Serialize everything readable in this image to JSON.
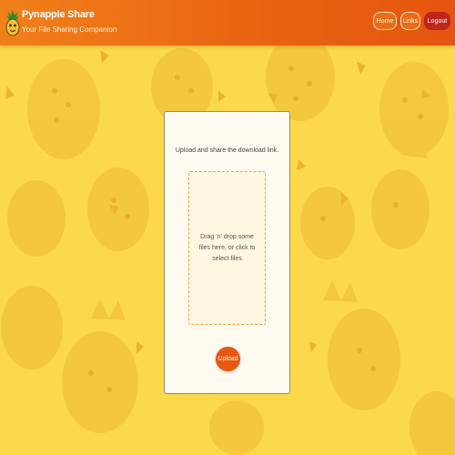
{
  "header": {
    "title": "Pynapple Share",
    "subtitle": "Your File Sharing Companion",
    "nav": {
      "home": "Home",
      "links": "Links",
      "logout": "Logout"
    }
  },
  "upload": {
    "caption": "Upload and share the download link.",
    "dropzone_text": "Drag 'n' drop some files here, or click to select files",
    "button_label": "Upload"
  },
  "colors": {
    "header": "#ea6412",
    "background": "#fcd949",
    "logout": "#c0251b",
    "upload_button": "#e8560f",
    "dropzone_border": "#f2a24a"
  },
  "icons": {
    "logo": "pineapple-logo-icon",
    "background": "pineapple-pattern"
  }
}
